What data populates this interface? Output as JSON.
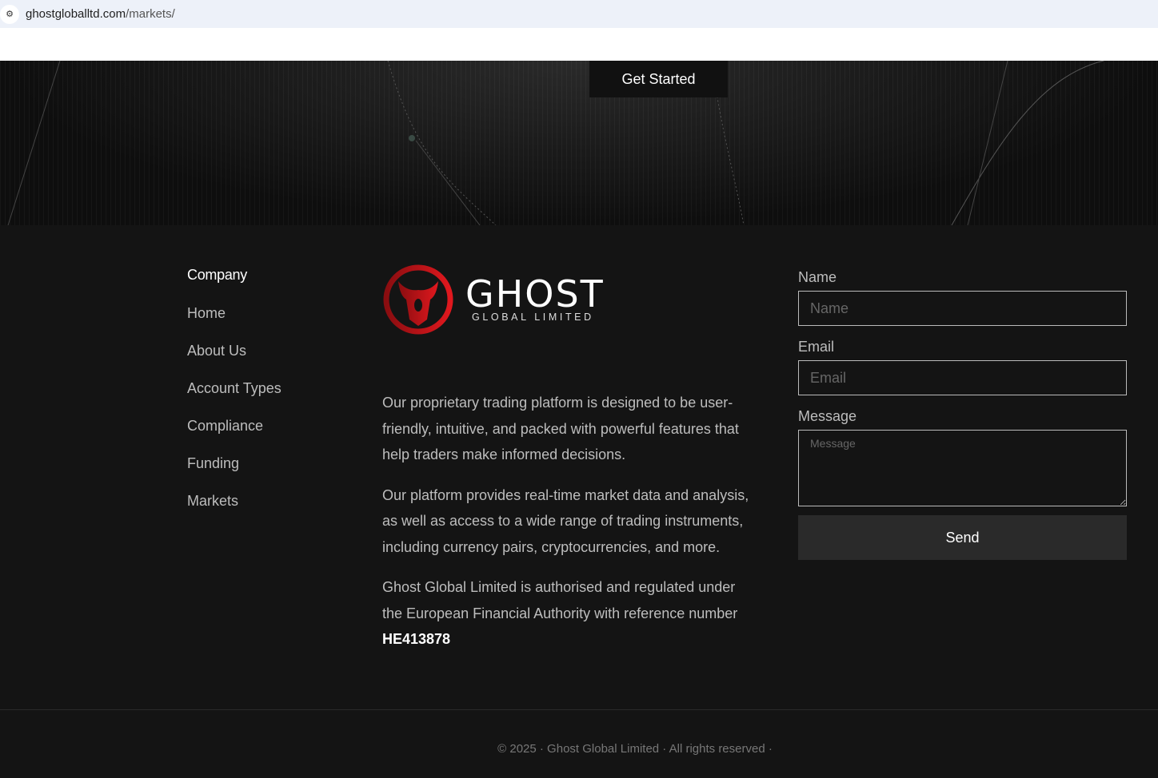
{
  "browser": {
    "url_host": "ghostgloballtd.com",
    "url_path": "/markets/"
  },
  "hero": {
    "cta": "Get Started"
  },
  "company": {
    "heading": "Company",
    "links": [
      "Home",
      "About Us",
      "Account Types",
      "Compliance",
      "Funding",
      "Markets"
    ]
  },
  "brand": {
    "name": "GHOST",
    "tagline": "GLOBAL LIMITED",
    "accent": "#d9151b"
  },
  "about": {
    "p1": "Our proprietary trading platform is designed to be user-friendly, intuitive, and packed with powerful features that help traders make informed decisions.",
    "p2": "Our platform provides real-time market data and analysis, as well as access to a wide range of trading instruments, including currency pairs, cryptocurrencies, and more.",
    "p3": "Ghost Global Limited is authorised and regulated under the European Financial Authority with reference number",
    "ref": "HE413878"
  },
  "form": {
    "name_label": "Name",
    "name_placeholder": "Name",
    "email_label": "Email",
    "email_placeholder": "Email",
    "message_label": "Message",
    "message_placeholder": "Message",
    "send": "Send"
  },
  "footer": {
    "copyright": "© 2025 · Ghost Global Limited · All rights reserved ·"
  }
}
